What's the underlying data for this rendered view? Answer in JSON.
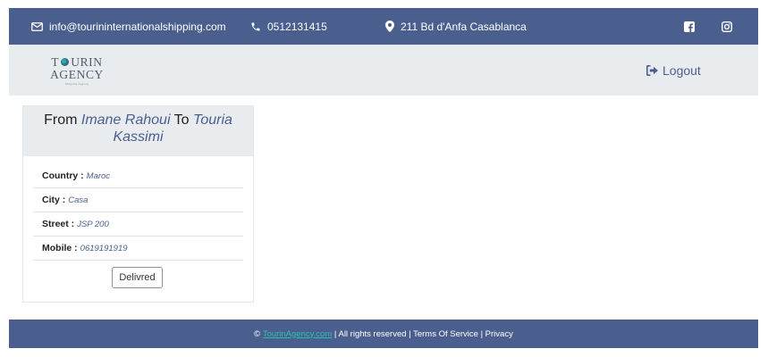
{
  "topbar": {
    "email": "info@tourininternationalshipping.com",
    "phone": "0512131415",
    "address": "211 Bd d'Anfa Casablanca",
    "icons": [
      "envelope-icon",
      "phone-icon",
      "map-marker-icon",
      "facebook-icon",
      "instagram-icon"
    ]
  },
  "navbar": {
    "logo_line1_a": "T",
    "logo_line1_b": "URIN",
    "logo_line2": "AGENCY",
    "logo_tagline": "Shipping Agency",
    "logout_label": "Logout"
  },
  "card": {
    "from_word": "From",
    "sender": "Imane Rahoui",
    "to_word": "To",
    "receiver": "Touria Kassimi",
    "rows": [
      {
        "label": "Country :",
        "value": "Maroc"
      },
      {
        "label": "City :",
        "value": "Casa"
      },
      {
        "label": "Street :",
        "value": "JSP 200"
      },
      {
        "label": "Mobile :",
        "value": "0619191919"
      }
    ],
    "button_label": "Delivred"
  },
  "footer": {
    "copyright": "©",
    "link_text": "TourinAgency.com",
    "rights": " | All rights reserved | Terms Of Service | Privacy"
  },
  "colors": {
    "primary": "#4b5f8f",
    "light_bg": "#e9ecef",
    "footer_link": "#26c0b0"
  }
}
